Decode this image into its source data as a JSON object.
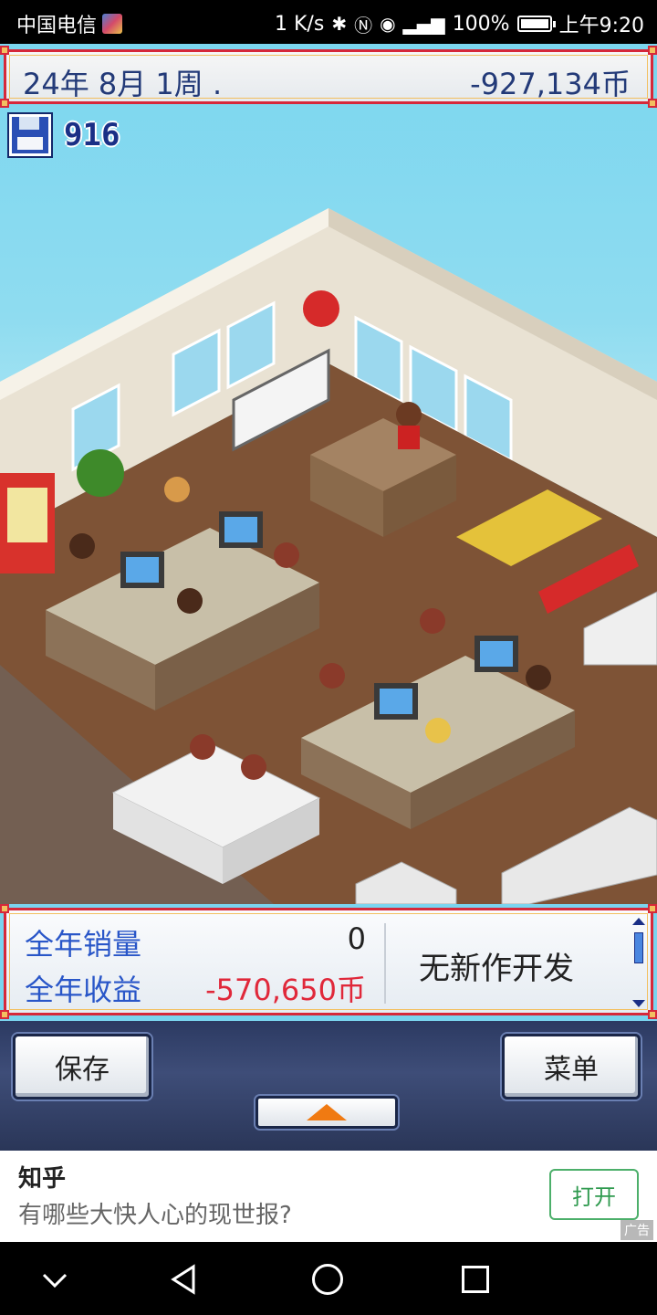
{
  "status_bar": {
    "carrier": "中国电信",
    "net_speed": "1 K/s",
    "battery": "100%",
    "time": "上午9:20",
    "icons": [
      "carrier-badge-icon",
      "bluetooth-icon",
      "nfc-icon",
      "eye-icon",
      "signal-icon",
      "battery-icon"
    ]
  },
  "game": {
    "date": "24年 8月 1周 .",
    "money": "-927,134币",
    "research_points": "916",
    "stats": {
      "sales_label": "全年销量",
      "sales_value": "0",
      "profit_label": "全年收益",
      "profit_value": "-570,650币",
      "dev_status": "无新作开发"
    },
    "buttons": {
      "save": "保存",
      "menu": "菜单"
    },
    "colors": {
      "frame_red": "#d6283a",
      "frame_gold": "#f2c060",
      "text_blue": "#2956c8",
      "negative_red": "#e0283a",
      "control_bar": "#2c3a62"
    }
  },
  "ad": {
    "title": "知乎",
    "text": "有哪些大快人心的现世报?",
    "open_button": "打开",
    "tag": "广告"
  }
}
